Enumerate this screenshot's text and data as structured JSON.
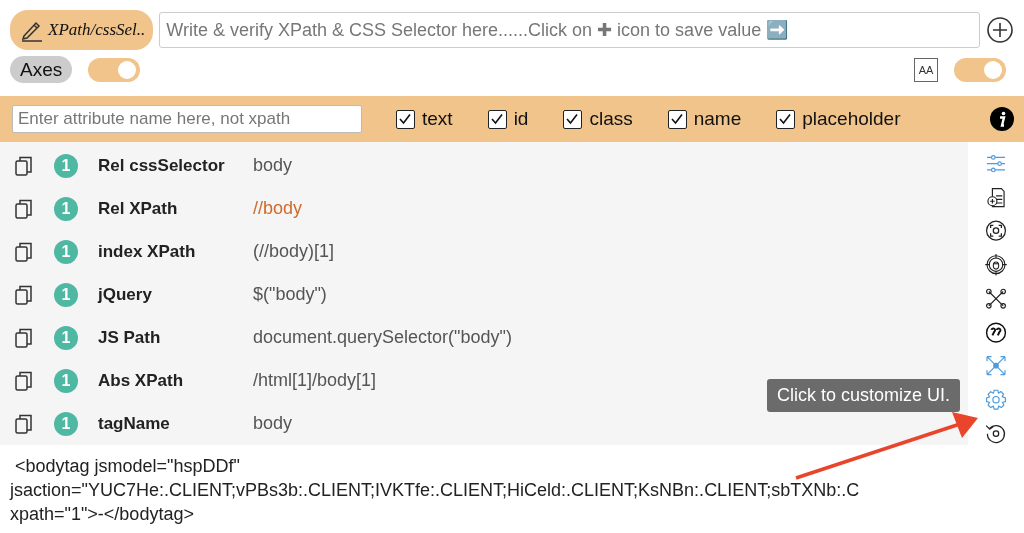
{
  "toolbar": {
    "mode_button": "XPath/cssSel..",
    "selector_field": {
      "placeholder": "Write & verify XPath & CSS Selector here......Click on ✚ icon to save value ➡️"
    },
    "axes_button": "Axes",
    "axes_toggle": {
      "on": true
    },
    "font_size_button": "AA",
    "font_toggle": {
      "on": true
    }
  },
  "attribute_bar": {
    "attribute_field": {
      "placeholder": "Enter attribute name here, not xpath"
    },
    "checkboxes": [
      {
        "label": "text",
        "checked": true
      },
      {
        "label": "id",
        "checked": true
      },
      {
        "label": "class",
        "checked": true
      },
      {
        "label": "name",
        "checked": true
      },
      {
        "label": "placeholder",
        "checked": true
      }
    ]
  },
  "results": [
    {
      "count": "1",
      "label": "Rel cssSelector",
      "value": "body",
      "highlighted": false
    },
    {
      "count": "1",
      "label": "Rel XPath",
      "value": "//body",
      "highlighted": true
    },
    {
      "count": "1",
      "label": "index XPath",
      "value": "(//body)[1]",
      "highlighted": false
    },
    {
      "count": "1",
      "label": "jQuery",
      "value": "$(\"body\")",
      "highlighted": false
    },
    {
      "count": "1",
      "label": "JS Path",
      "value": "document.querySelector(\"body\")",
      "highlighted": false
    },
    {
      "count": "1",
      "label": "Abs XPath",
      "value": "/html[1]/body[1]",
      "highlighted": false
    },
    {
      "count": "1",
      "label": "tagName",
      "value": "body",
      "highlighted": false
    }
  ],
  "tooltip": "Click to customize UI.",
  "dom_snippet": [
    " <bodytag jsmodel=\"hspDDf\"",
    "jsaction=\"YUC7He:.CLIENT;vPBs3b:.CLIENT;IVKTfe:.CLIENT;HiCeld:.CLIENT;KsNBn:.CLIENT;sbTXNb:.C",
    "xpath=\"1\">-</bodytag>"
  ]
}
